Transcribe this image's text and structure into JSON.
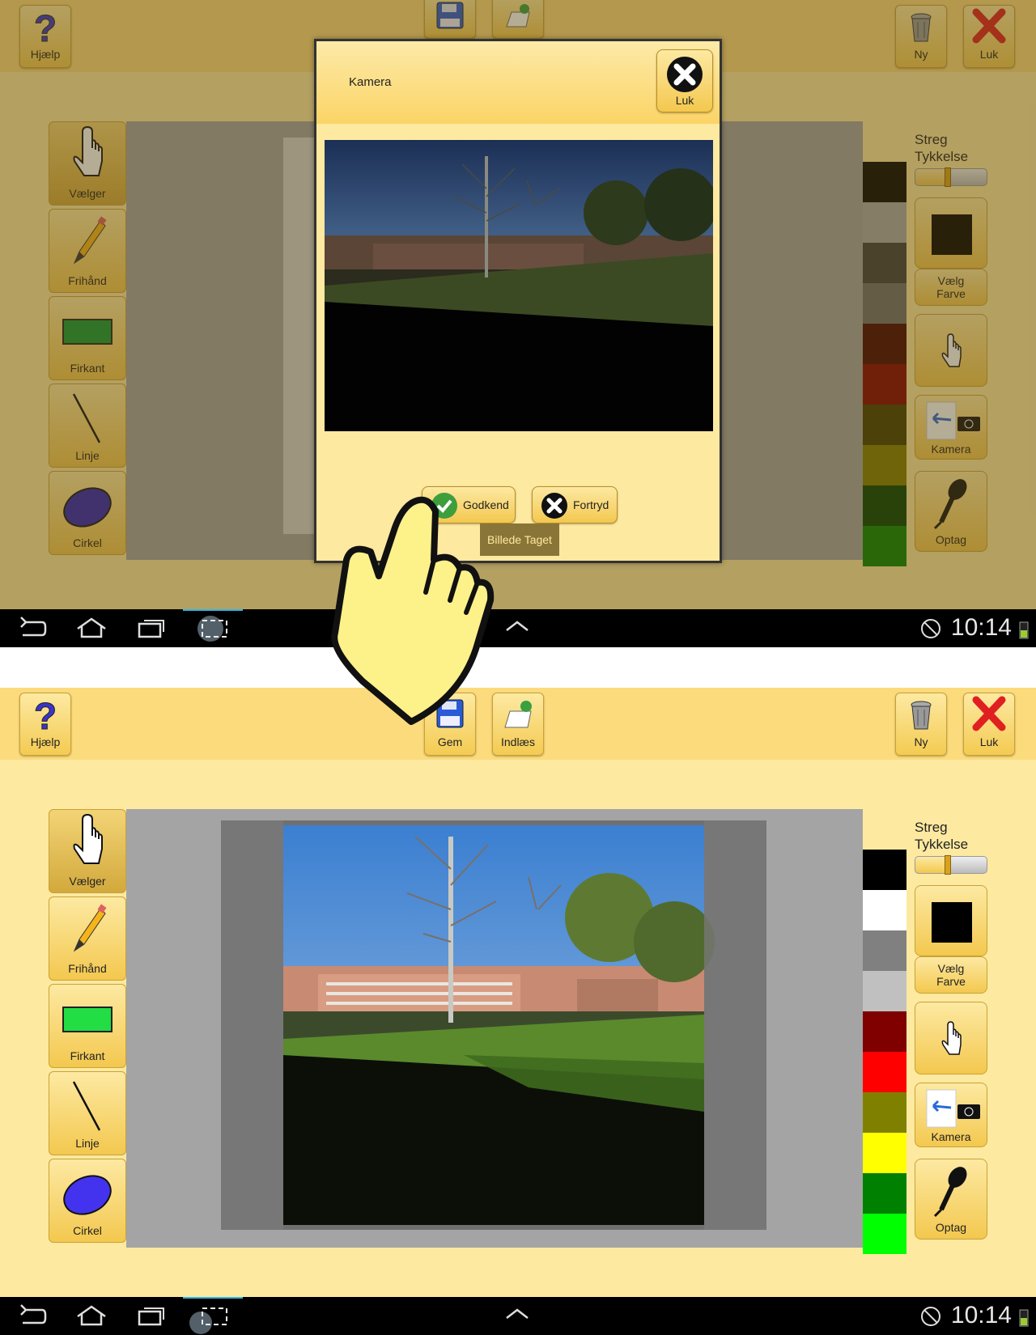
{
  "toolbar": {
    "help": "Hjælp",
    "save": "Gem",
    "load": "Indlæs",
    "new": "Ny",
    "close": "Luk"
  },
  "tools": [
    {
      "label": "Vælger",
      "icon": "hand-pointer-icon"
    },
    {
      "label": "Frihånd",
      "icon": "pencil-icon"
    },
    {
      "label": "Firkant",
      "icon": "rectangle-icon"
    },
    {
      "label": "Linje",
      "icon": "line-icon"
    },
    {
      "label": "Cirkel",
      "icon": "ellipse-icon"
    }
  ],
  "right_panel": {
    "streg": "Streg",
    "tykkelse": "Tykkelse",
    "thickness_level": 0.45,
    "choose_color_line1": "Vælg",
    "choose_color_line2": "Farve",
    "selected_color": "#000000",
    "camera": "Kamera",
    "record": "Optag"
  },
  "palette": {
    "top": [
      "#000000",
      "#a9a9a9",
      "#3f3f3f",
      "#6d6d6d",
      "#430000",
      "#820000",
      "#3f3d00",
      "#807c00",
      "#003f00",
      "#008200"
    ],
    "bottom": [
      "#000000",
      "#ffffff",
      "#808080",
      "#c0c0c0",
      "#800000",
      "#ff0000",
      "#808000",
      "#ffff00",
      "#008000",
      "#00ff00"
    ]
  },
  "dialog": {
    "title": "Kamera",
    "close": "Luk",
    "approve": "Godkend",
    "cancel": "Fortryd",
    "toast": "Billede Taget"
  },
  "statusbar": {
    "time": "10:14"
  },
  "colors": {
    "toolbar_bg": "#fcdb7c",
    "screen_bg": "#fde9a0",
    "canvas_bg": "#a4a4a4",
    "accent_close": "#e02020"
  }
}
